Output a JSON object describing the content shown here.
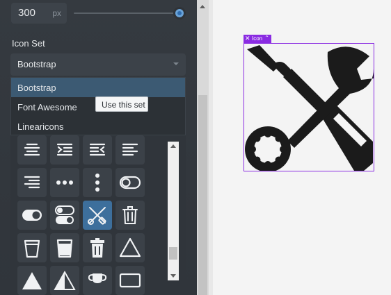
{
  "width_control": {
    "value": "300",
    "unit": "px"
  },
  "section": {
    "icon_set_label": "Icon Set"
  },
  "select": {
    "selected": "Bootstrap"
  },
  "dropdown": {
    "options": [
      "Bootstrap",
      "Font Awesome",
      "Linearicons"
    ]
  },
  "tooltip": {
    "text": "Use this set"
  },
  "canvas": {
    "element_tag": "Icon"
  },
  "icon_grid": {
    "icons": [
      "text-center-icon",
      "text-indent-right-icon",
      "text-indent-left-icon",
      "text-left-icon",
      "text-right-icon",
      "three-dots-icon",
      "three-dots-vertical-icon",
      "toggle-off-icon",
      "toggle-on-icon",
      "toggles-icon",
      "tools-icon",
      "trash-icon",
      "cup-icon",
      "cup-straight-icon",
      "trash-fill-icon",
      "triangle-icon",
      "triangle-fill-icon",
      "triangle-half-icon",
      "trophy-icon",
      "tv-icon"
    ],
    "selected": "tools-icon"
  },
  "colors": {
    "accent": "#8a2be2",
    "panel": "#2f3338",
    "selected_tile": "#3d6f9c",
    "dropdown_active": "#3c5a73"
  }
}
